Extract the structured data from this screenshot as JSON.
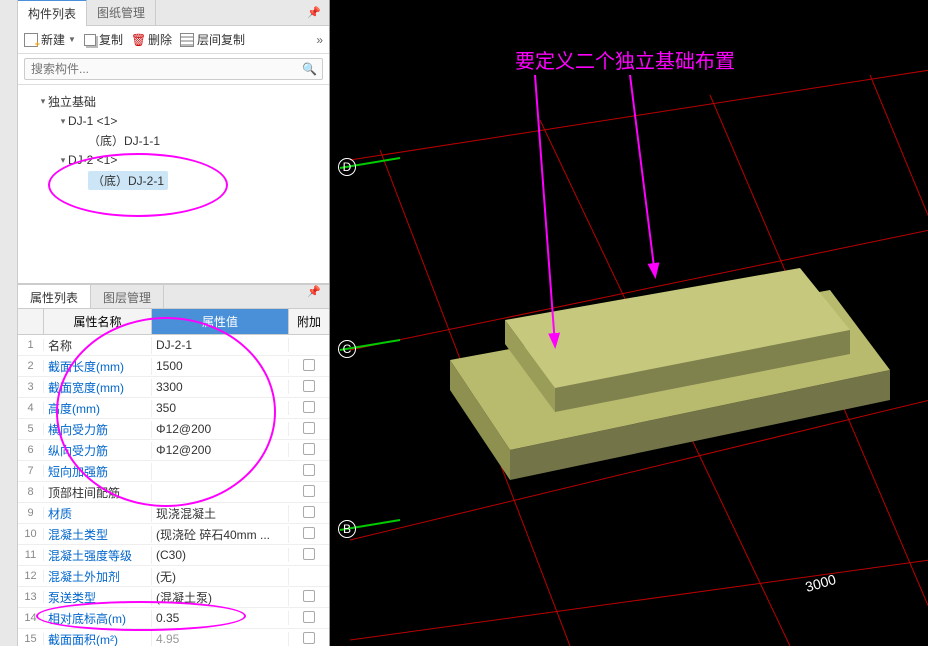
{
  "tabs": {
    "components": "构件列表",
    "drawings": "图纸管理"
  },
  "toolbar": {
    "new": "新建",
    "copy": "复制",
    "del": "删除",
    "layer_copy": "层间复制"
  },
  "search": {
    "placeholder": "搜索构件..."
  },
  "tree": {
    "root": "独立基础",
    "dj1": "DJ-1 <1>",
    "dj1_1": "（底）DJ-1-1",
    "dj2": "DJ-2 <1>",
    "dj2_1": "（底）DJ-2-1"
  },
  "prop_tabs": {
    "props": "属性列表",
    "layers": "图层管理"
  },
  "grid_head": {
    "name": "属性名称",
    "val": "属性值",
    "ext": "附加"
  },
  "rows": [
    {
      "n": "1",
      "name": "名称",
      "val": "DJ-2-1",
      "link": false,
      "gray": false,
      "chk": false
    },
    {
      "n": "2",
      "name": "截面长度(mm)",
      "val": "1500",
      "link": true,
      "gray": false,
      "chk": true
    },
    {
      "n": "3",
      "name": "截面宽度(mm)",
      "val": "3300",
      "link": true,
      "gray": false,
      "chk": true
    },
    {
      "n": "4",
      "name": "高度(mm)",
      "val": "350",
      "link": true,
      "gray": false,
      "chk": true
    },
    {
      "n": "5",
      "name": "横向受力筋",
      "val": "Φ12@200",
      "link": true,
      "gray": false,
      "chk": true
    },
    {
      "n": "6",
      "name": "纵向受力筋",
      "val": "Φ12@200",
      "link": true,
      "gray": false,
      "chk": true
    },
    {
      "n": "7",
      "name": "短向加强筋",
      "val": "",
      "link": true,
      "gray": false,
      "chk": true
    },
    {
      "n": "8",
      "name": "顶部柱间配筋",
      "val": "",
      "link": false,
      "gray": false,
      "chk": true
    },
    {
      "n": "9",
      "name": "材质",
      "val": "现浇混凝土",
      "link": true,
      "gray": false,
      "chk": true
    },
    {
      "n": "10",
      "name": "混凝土类型",
      "val": "(现浇砼 碎石40mm ...",
      "link": true,
      "gray": false,
      "chk": true
    },
    {
      "n": "11",
      "name": "混凝土强度等级",
      "val": "(C30)",
      "link": true,
      "gray": false,
      "chk": true
    },
    {
      "n": "12",
      "name": "混凝土外加剂",
      "val": "(无)",
      "link": true,
      "gray": false,
      "chk": false
    },
    {
      "n": "13",
      "name": "泵送类型",
      "val": "(混凝土泵)",
      "link": true,
      "gray": false,
      "chk": true
    },
    {
      "n": "14",
      "name": "相对底标高(m)",
      "val": "0.35",
      "link": true,
      "gray": false,
      "chk": true
    },
    {
      "n": "15",
      "name": "截面面积(m²)",
      "val": "4.95",
      "link": true,
      "gray": true,
      "chk": true
    }
  ],
  "viewport": {
    "annotation": "要定义二个独立基础布置",
    "axis_b": "B",
    "axis_c": "C",
    "axis_d": "D",
    "dim_3000": "3000"
  }
}
